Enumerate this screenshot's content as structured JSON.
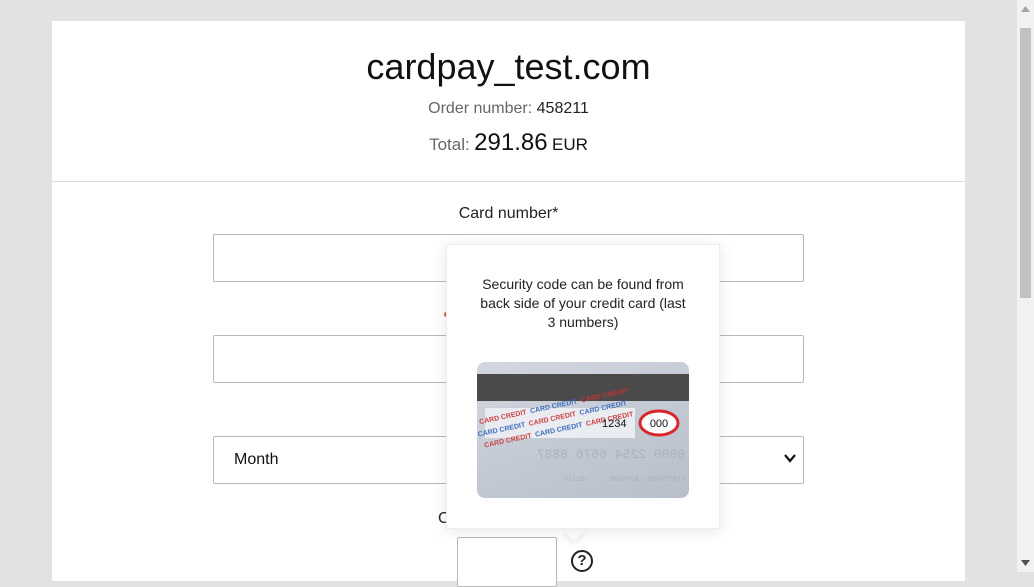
{
  "header": {
    "site_name": "cardpay_test.com",
    "order_label": "Order number:",
    "order_number": "458211",
    "total_label": "Total:",
    "total_amount": "291.86",
    "currency": "EUR"
  },
  "form": {
    "card_number_label": "Card number*",
    "card_number_value": "",
    "cardholder_value": "",
    "expiry_month_selected": "Month",
    "cvv_label_visible_fragment": "C",
    "cvv_value": ""
  },
  "tooltip": {
    "text": "Security code can be found from back side of your credit card (last 3 numbers)",
    "card": {
      "back_digits": "1234",
      "security_code": "000",
      "embossed_number": "0000 2254 6676 8887",
      "embossed_name": "FIRSTNAME LASTNAME",
      "embossed_expiry": "01/16",
      "pattern_text": "CARD CREDIT"
    }
  },
  "icons": {
    "help": "?",
    "chevron": "chevron-down-icon"
  },
  "colors": {
    "background": "#e2e2e2",
    "panel": "#ffffff",
    "accent_dot": "#e4572e",
    "highlight_circle": "#d9262c",
    "magstripe": "#4a4a4a"
  }
}
